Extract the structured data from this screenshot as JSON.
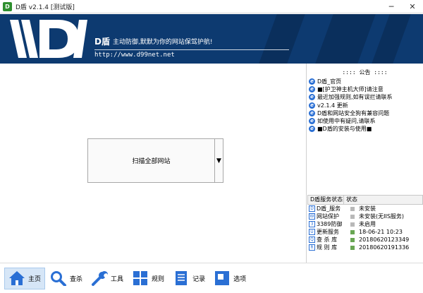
{
  "window": {
    "title": "D盾 v2.1.4 [测试版]",
    "icon_letter": "D",
    "minimize": "─",
    "close": "✕"
  },
  "banner": {
    "brand": "D盾",
    "slogan": "主动防御,默默为你的网站保驾护航!",
    "url": "http://www.d99net.net"
  },
  "main": {
    "scan_button": "扫描全部网站",
    "scan_dropdown": "▼"
  },
  "announcement": {
    "title": ":::: 公告 ::::",
    "items": [
      "D盾_官页",
      "■[护卫神主机大师]请注意",
      "最近加强规则,如有误拦请联系",
      "v2.1.4 更新",
      "D盾和网站安全狗有兼容问题",
      "如使用中有疑问,请联系",
      "■D盾的安装与使用■"
    ]
  },
  "services": {
    "header_name": "D盾服务状态",
    "header_status": "状态",
    "rows": [
      {
        "icon": "D",
        "name": "D盾_服务",
        "status": "未安装",
        "on": false
      },
      {
        "icon": "W",
        "name": "网站保护",
        "status": "未安装(无IIS服务)",
        "on": false
      },
      {
        "icon": "3",
        "name": "3389防御",
        "status": "未启用",
        "on": false
      },
      {
        "icon": "U",
        "name": "更新服务",
        "status": "18-06-21 10:23",
        "on": true
      },
      {
        "icon": "Q",
        "name": "查 杀 库",
        "status": "20180620123349",
        "on": true
      },
      {
        "icon": "R",
        "name": "规 则 库",
        "status": "20180620191336",
        "on": true
      }
    ]
  },
  "toolbar": {
    "home": "主页",
    "scan": "查杀",
    "tools": "工具",
    "rules": "规则",
    "logs": "记录",
    "options": "选项"
  },
  "colors": {
    "banner_bg": "#0d3a70",
    "accent": "#2a6fd4",
    "status_on": "#69a653"
  }
}
